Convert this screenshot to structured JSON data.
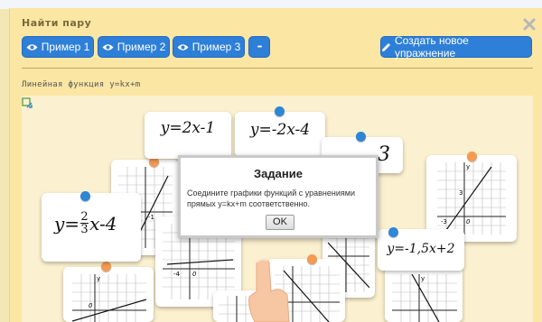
{
  "panel": {
    "title": "Найти пару"
  },
  "toolbar": {
    "example1": "Пример 1",
    "example2": "Пример 2",
    "example3": "Пример 3",
    "more": "•••",
    "create": "Создать новое упражнение"
  },
  "exercise": {
    "title": "Линейная функция y=kx+m"
  },
  "cards": {
    "eq1": "y=2x-1",
    "eq2": "y=-2x-4",
    "eq3_fragment": "3",
    "eq4_left": "y=",
    "eq4_num": "2",
    "eq4_den": "3",
    "eq4_right": "x-4",
    "eq5": "y=-1,5x+2"
  },
  "graph_labels": {
    "y": "y",
    "zero": "0",
    "minus1": "-1",
    "minus3": "-3",
    "three": "3",
    "two": "2",
    "minus4": "-4",
    "minus1b": "1"
  },
  "modal": {
    "title": "Задание",
    "text": "Соедините графики функций с уравнениями прямых y=kx+m соответственно.",
    "ok": "OK"
  },
  "colors": {
    "accent": "#2e7fd8",
    "panel": "#fbe6a4",
    "dot_blue": "#2e86d6",
    "dot_orange": "#f59a52"
  }
}
